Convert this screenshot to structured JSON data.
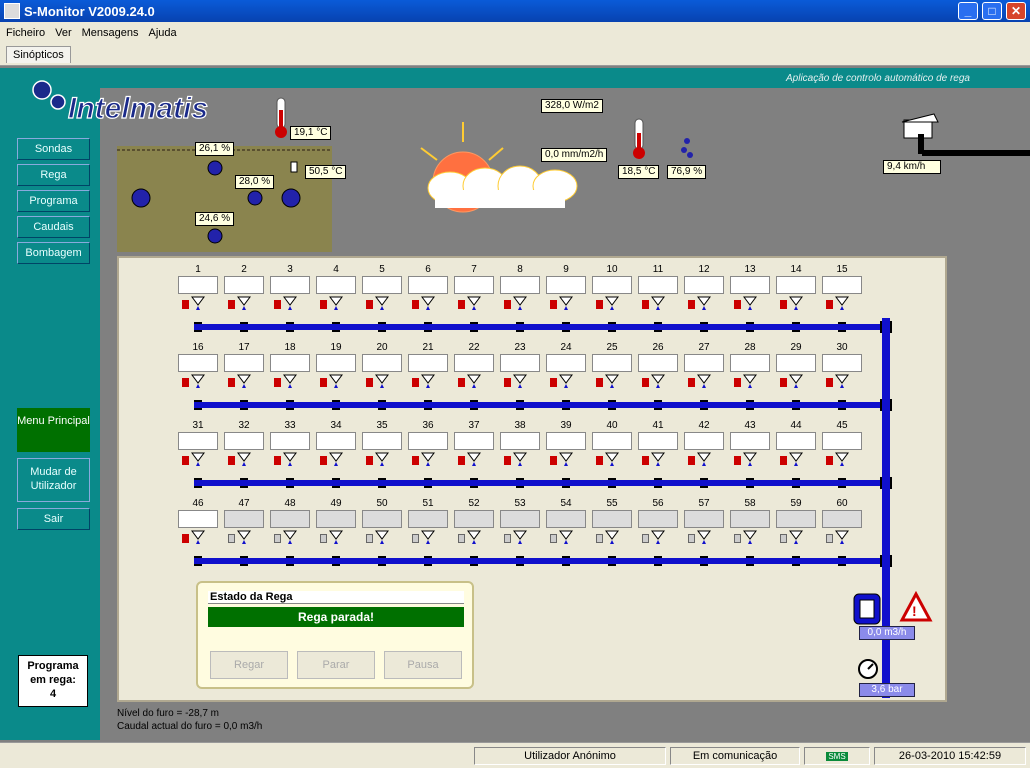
{
  "window": {
    "title": "S-Monitor V2009.24.0"
  },
  "menu": [
    "Ficheiro",
    "Ver",
    "Mensagens",
    "Ajuda"
  ],
  "tab": "Sinópticos",
  "header": {
    "tagline": "Aplicação de controlo automático de rega",
    "logo": "Intelmatis"
  },
  "sidebar": {
    "items": [
      "Sondas",
      "Rega",
      "Programa",
      "Caudais",
      "Bombagem"
    ],
    "menu_principal": "Menu Principal",
    "mudar_utilizador": "Mudar de Utilizador",
    "sair": "Sair",
    "programa_label": "Programa em rega:",
    "programa_value": "4"
  },
  "soil": {
    "air_temp": "19,1 °C",
    "soil_temp": "50,5 °C",
    "moisture1": "26,1 %",
    "moisture2": "28,0 %",
    "moisture3": "24,6 %"
  },
  "weather": {
    "radiation": "328,0 W/m2",
    "rain": "0,0 mm/m2/h",
    "temp": "18,5 °C",
    "humidity": "76,9 %",
    "wind": "9,4 km/h"
  },
  "sectors": [
    "1",
    "2",
    "3",
    "4",
    "5",
    "6",
    "7",
    "8",
    "9",
    "10",
    "11",
    "12",
    "13",
    "14",
    "15",
    "16",
    "17",
    "18",
    "19",
    "20",
    "21",
    "22",
    "23",
    "24",
    "25",
    "26",
    "27",
    "28",
    "29",
    "30",
    "31",
    "32",
    "33",
    "34",
    "35",
    "36",
    "37",
    "38",
    "39",
    "40",
    "41",
    "42",
    "43",
    "44",
    "45",
    "46",
    "47",
    "48",
    "49",
    "50",
    "51",
    "52",
    "53",
    "54",
    "55",
    "56",
    "57",
    "58",
    "59",
    "60"
  ],
  "estado": {
    "title": "Estado da Rega",
    "status": "Rega parada!",
    "buttons": {
      "regar": "Regar",
      "parar": "Parar",
      "pausa": "Pausa"
    }
  },
  "flow": {
    "caudal": "0,0 m3/h",
    "pressure": "3,6 bar"
  },
  "bottom": {
    "nivel": "Nível do furo = -28,7 m",
    "caudal": "Caudal actual do furo = 0,0 m3/h"
  },
  "statusbar": {
    "user": "Utilizador Anónimo",
    "comm": "Em comunicação",
    "sms": "SMS",
    "datetime": "26-03-2010 15:42:59"
  }
}
